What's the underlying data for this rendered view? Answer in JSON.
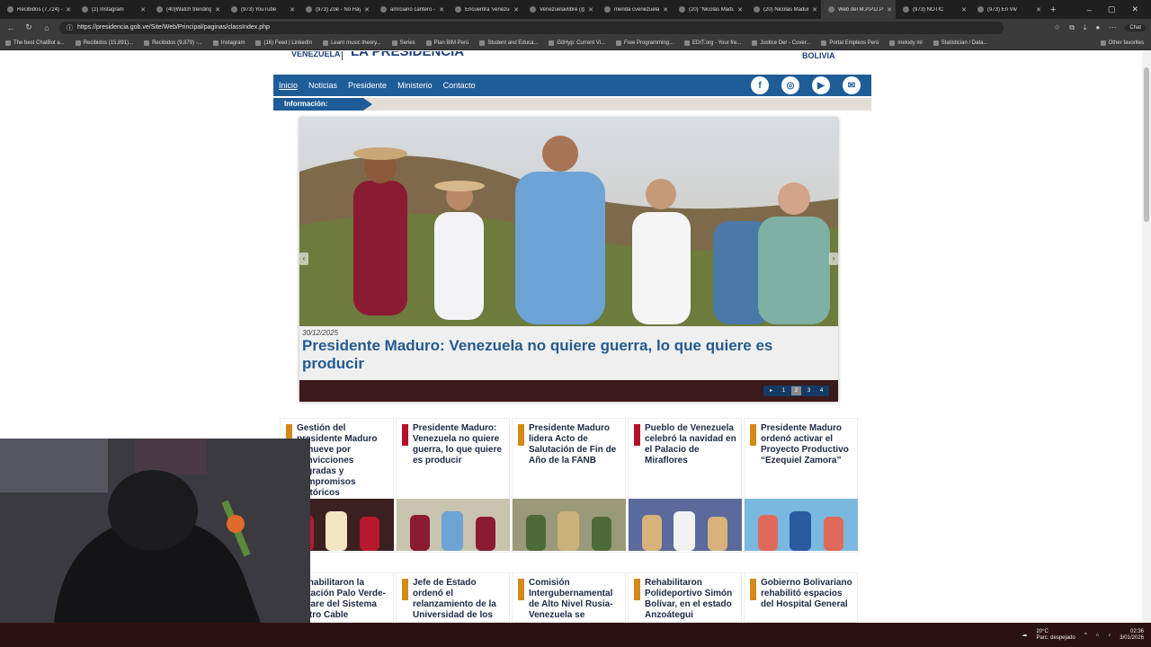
{
  "browser": {
    "tabs": [
      {
        "label": "Recibidos (7,724) - c"
      },
      {
        "label": "(2) Instagram"
      },
      {
        "label": "(40)Watch trending -"
      },
      {
        "label": "(973) YouTube"
      },
      {
        "label": "(973) Zoé - No Hay I"
      },
      {
        "label": "amrciano cantero -"
      },
      {
        "label": "Encuentra 'venezueli"
      },
      {
        "label": "Venezuelavlibre (@"
      },
      {
        "label": "merida cvenezuela -"
      },
      {
        "label": "(20) \"Nicolás Madur"
      },
      {
        "label": "(20) Nicolás Maduro"
      },
      {
        "label": "Web del M.P.P.D.P.S"
      },
      {
        "label": "(973) NOTIC"
      },
      {
        "label": "(973) En Viv"
      }
    ],
    "url": "https://presidencia.gob.ve/Site/Web/Principal/paginas/classIndex.php",
    "chat_label": "Chat",
    "bookmarks": [
      {
        "label": "The best ChatBot a..."
      },
      {
        "label": "Recibidos (15,891)..."
      },
      {
        "label": "Recibidos (9,879) -..."
      },
      {
        "label": "Instagram"
      },
      {
        "label": "(16) Feed | LinkedIn"
      },
      {
        "label": "Learn music theory..."
      },
      {
        "label": "Series"
      },
      {
        "label": "Plan BIM Perú"
      },
      {
        "label": "Student and Educa..."
      },
      {
        "label": "GitHyp: Current Vi..."
      },
      {
        "label": "Free Programming..."
      },
      {
        "label": "EDIT.org - Your fre..."
      },
      {
        "label": "Justice Der - Cover..."
      },
      {
        "label": "Portal Empleos Perú"
      },
      {
        "label": "melody ml"
      },
      {
        "label": "Statistician / Data..."
      }
    ],
    "other_favorites": "Other favorites"
  },
  "site": {
    "header_left": "VENEZUELA",
    "header_brand": "LA PRESIDENCIA",
    "header_right": "BOLIVIA",
    "nav": [
      {
        "label": "Inicio"
      },
      {
        "label": "Noticias"
      },
      {
        "label": "Presidente"
      },
      {
        "label": "Ministerio"
      },
      {
        "label": "Contacto"
      }
    ],
    "social": [
      {
        "icon": "facebook-icon",
        "glyph": "f"
      },
      {
        "icon": "instagram-icon",
        "glyph": "◎"
      },
      {
        "icon": "youtube-icon",
        "glyph": "▶"
      },
      {
        "icon": "email-icon",
        "glyph": "✉"
      }
    ],
    "info_label": "Información:",
    "slider": {
      "date": "30/12/2025",
      "title": "Presidente Maduro: Venezuela no quiere guerra, lo que quiere es producir",
      "pages": [
        "1",
        "2",
        "3",
        "4"
      ],
      "active_page": "2"
    },
    "news_row1": [
      {
        "title": "Gestión del presidente Maduro remueve por convicciones sagradas y compromisos históricos",
        "color": "#d48a1a"
      },
      {
        "title": "Presidente Maduro: Venezuela no quiere guerra, lo que quiere es producir",
        "color": "#b3102a"
      },
      {
        "title": "Presidente Maduro lidera Acto de Salutación de Fin de Año de la FANB",
        "color": "#d48a1a"
      },
      {
        "title": "Pueblo de Venezuela celebró la navidad en el Palacio de Miraflores",
        "color": "#b3102a"
      },
      {
        "title": "Presidente Maduro ordenó activar el Proyecto Productivo “Ezequiel Zamora”",
        "color": "#d48a1a"
      }
    ],
    "news_row2": [
      {
        "title": "Rehabilitaron la Estación Palo Verde-Petare del Sistema Metro Cable",
        "color": "#d48a1a"
      },
      {
        "title": "Jefe de Estado ordenó el relanzamiento de la Universidad de los",
        "color": "#d48a1a"
      },
      {
        "title": "Comisión Intergubernamental de Alto Nivel Rusia-Venezuela se",
        "color": "#d48a1a"
      },
      {
        "title": "Rehabilitaron Polideportivo Simón Bolívar, en el estado Anzoátegui",
        "color": "#d48a1a"
      },
      {
        "title": "Gobierno Bolivariano rehabilitó espacios del Hospital General",
        "color": "#d48a1a"
      }
    ]
  },
  "taskbar": {
    "temp": "20°C",
    "weather": "Parc. despejado",
    "time": "02:36",
    "date": "3/01/2026"
  }
}
